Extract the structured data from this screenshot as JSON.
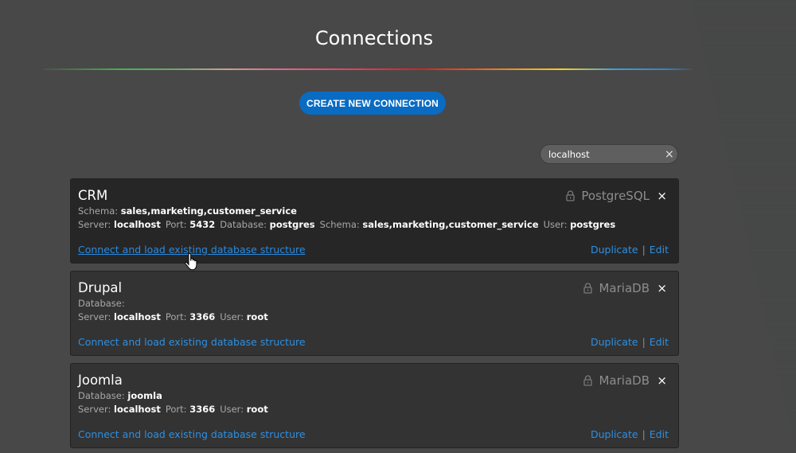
{
  "page": {
    "title": "Connections",
    "create_button": "CREATE NEW CONNECTION",
    "search": {
      "value": "localhost",
      "placeholder": "",
      "clear_icon": "×"
    }
  },
  "colors": {
    "background": "#484848",
    "accent": "#0a6bc2",
    "link": "#2e8fe0"
  },
  "connections": [
    {
      "name": "CRM",
      "type": "PostgreSQL",
      "line1": [
        {
          "label": "Schema:",
          "value": "sales,marketing,customer_service"
        }
      ],
      "line2": [
        {
          "label": "Server:",
          "value": "localhost"
        },
        {
          "label": "Port:",
          "value": "5432"
        },
        {
          "label": "Database:",
          "value": "postgres"
        },
        {
          "label": "Schema:",
          "value": "sales,marketing,customer_service"
        },
        {
          "label": "User:",
          "value": "postgres"
        }
      ],
      "link": "Connect and load existing database structure",
      "duplicate": "Duplicate",
      "separator": "|",
      "edit": "Edit",
      "close": "×",
      "active": true
    },
    {
      "name": "Drupal",
      "type": "MariaDB",
      "line1": [
        {
          "label": "Database:",
          "value": ""
        }
      ],
      "line2": [
        {
          "label": "Server:",
          "value": "localhost"
        },
        {
          "label": "Port:",
          "value": "3366"
        },
        {
          "label": "User:",
          "value": "root"
        }
      ],
      "link": "Connect and load existing database structure",
      "duplicate": "Duplicate",
      "separator": "|",
      "edit": "Edit",
      "close": "×",
      "active": false
    },
    {
      "name": "Joomla",
      "type": "MariaDB",
      "line1": [
        {
          "label": "Database:",
          "value": "joomla"
        }
      ],
      "line2": [
        {
          "label": "Server:",
          "value": "localhost"
        },
        {
          "label": "Port:",
          "value": "3366"
        },
        {
          "label": "User:",
          "value": "root"
        }
      ],
      "link": "Connect and load existing database structure",
      "duplicate": "Duplicate",
      "separator": "|",
      "edit": "Edit",
      "close": "×",
      "active": false
    }
  ]
}
